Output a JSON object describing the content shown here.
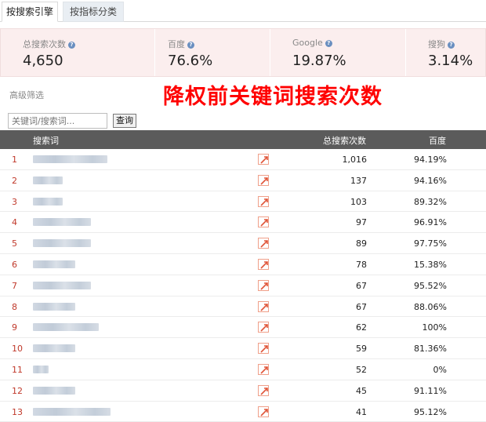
{
  "tabs": [
    {
      "label": "按搜索引擎",
      "active": true
    },
    {
      "label": "按指标分类",
      "active": false
    }
  ],
  "stats": [
    {
      "label": "总搜索次数",
      "value": "4,650"
    },
    {
      "label": "百度",
      "value": "76.6%"
    },
    {
      "label": "Google",
      "value": "19.87%"
    },
    {
      "label": "搜狗",
      "value": "3.14%"
    }
  ],
  "help_icon_glyph": "?",
  "filter": {
    "label": "高级筛选"
  },
  "overlay_title": "降权前关键词搜索次数",
  "search": {
    "placeholder": "关键词/搜索词...",
    "button": "查询"
  },
  "table": {
    "headers": {
      "term": "搜索词",
      "count": "总搜索次数",
      "pct": "百度"
    },
    "rows": [
      {
        "rank": "1",
        "count": "1,016",
        "pct": "94.19%",
        "term_blur": 0.83
      },
      {
        "rank": "2",
        "count": "137",
        "pct": "94.16%",
        "term_blur": 0.33
      },
      {
        "rank": "3",
        "count": "103",
        "pct": "89.32%",
        "term_blur": 0.33
      },
      {
        "rank": "4",
        "count": "97",
        "pct": "96.91%",
        "term_blur": 0.64
      },
      {
        "rank": "5",
        "count": "89",
        "pct": "97.75%",
        "term_blur": 0.64
      },
      {
        "rank": "6",
        "count": "78",
        "pct": "15.38%",
        "term_blur": 0.47
      },
      {
        "rank": "7",
        "count": "67",
        "pct": "95.52%",
        "term_blur": 0.64
      },
      {
        "rank": "8",
        "count": "67",
        "pct": "88.06%",
        "term_blur": 0.47
      },
      {
        "rank": "9",
        "count": "62",
        "pct": "100%",
        "term_blur": 0.73
      },
      {
        "rank": "10",
        "count": "59",
        "pct": "81.36%",
        "term_blur": 0.47
      },
      {
        "rank": "11",
        "count": "52",
        "pct": "0%",
        "term_blur": 0.17
      },
      {
        "rank": "12",
        "count": "45",
        "pct": "91.11%",
        "term_blur": 0.47
      },
      {
        "rank": "13",
        "count": "41",
        "pct": "95.12%",
        "term_blur": 0.86
      }
    ]
  },
  "colors": {
    "rank": "#c0392b",
    "title": "#ff0000",
    "header_bg": "#5b5b5b",
    "stats_bg": "#fbeeee"
  }
}
